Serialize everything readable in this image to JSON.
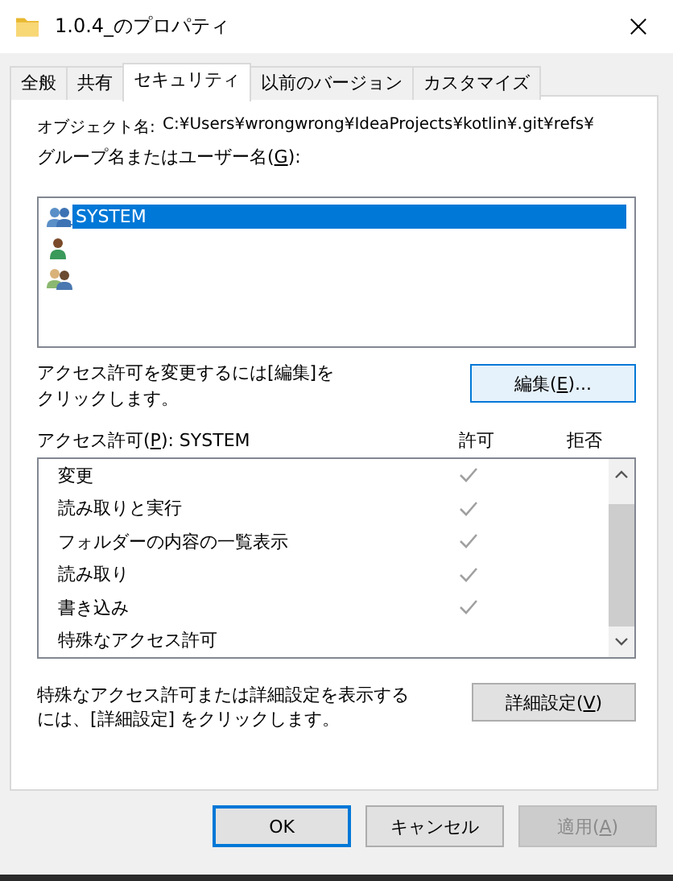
{
  "window": {
    "title": "1.0.4_のプロパティ"
  },
  "tabs": [
    {
      "label": "全般",
      "selected": false
    },
    {
      "label": "共有",
      "selected": false
    },
    {
      "label": "セキュリティ",
      "selected": true
    },
    {
      "label": "以前のバージョン",
      "selected": false
    },
    {
      "label": "カスタマイズ",
      "selected": false
    }
  ],
  "object_name": {
    "label": "オブジェクト名:",
    "value": "C:¥Users¥wrongwrong¥IdeaProjects¥kotlin¥.git¥refs¥"
  },
  "principals_label": {
    "before": "グループ名またはユーザー名(",
    "mnemonic": "G",
    "after": "):"
  },
  "principals": [
    {
      "kind": "group",
      "name": "SYSTEM",
      "selected": true
    },
    {
      "kind": "user",
      "selected": false
    },
    {
      "kind": "users",
      "selected": false
    }
  ],
  "edit_hint": "アクセス許可を変更するには[編集]をクリックします。",
  "edit_button": {
    "before": "編集(",
    "mnemonic": "E",
    "after": ")..."
  },
  "permissions_label": {
    "before": "アクセス許可(",
    "mnemonic": "P",
    "after": "): SYSTEM"
  },
  "columns": [
    "許可",
    "拒否"
  ],
  "permissions": [
    {
      "name": "変更",
      "allow": true,
      "deny": false
    },
    {
      "name": "読み取りと実行",
      "allow": true,
      "deny": false
    },
    {
      "name": "フォルダーの内容の一覧表示",
      "allow": true,
      "deny": false
    },
    {
      "name": "読み取り",
      "allow": true,
      "deny": false
    },
    {
      "name": "書き込み",
      "allow": true,
      "deny": false
    },
    {
      "name": "特殊なアクセス許可",
      "allow": false,
      "deny": false
    }
  ],
  "advanced_hint": "特殊なアクセス許可または詳細設定を表示するには、[詳細設定] をクリックします。",
  "advanced_button": {
    "before": "詳細設定(",
    "mnemonic": "V",
    "after": ")"
  },
  "buttons": [
    {
      "before": "OK",
      "disabled": false,
      "default": true
    },
    {
      "before": "キャンセル",
      "disabled": false,
      "default": false
    },
    {
      "before": "適用(",
      "mnemonic": "A",
      "after": ")",
      "disabled": true,
      "default": false
    }
  ]
}
